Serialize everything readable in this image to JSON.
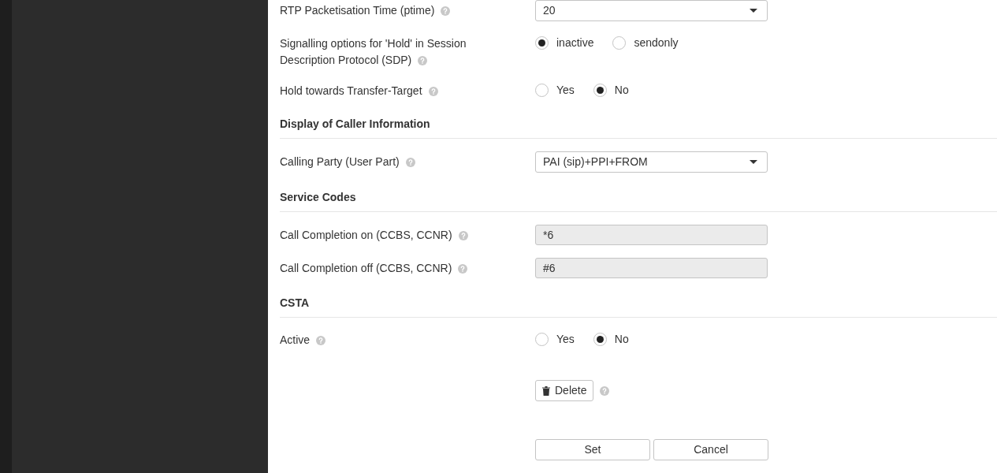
{
  "form": [
    {
      "kind": "select",
      "label": "RTP Packetisation Time (ptime)",
      "help": true,
      "value": "20"
    },
    {
      "kind": "radio",
      "label": "Signalling options for 'Hold' in Session Description Protocol (SDP)",
      "help": true,
      "options": [
        {
          "label": "inactive",
          "selected": true
        },
        {
          "label": "sendonly",
          "selected": false
        }
      ]
    },
    {
      "kind": "radio",
      "label": "Hold towards Transfer-Target",
      "help": true,
      "options": [
        {
          "label": "Yes",
          "selected": false
        },
        {
          "label": "No",
          "selected": true
        }
      ]
    },
    {
      "kind": "heading",
      "label": "Display of Caller Information"
    },
    {
      "kind": "select",
      "label": "Calling Party (User Part)",
      "help": true,
      "value": "PAI (sip)+PPI+FROM"
    },
    {
      "kind": "heading",
      "label": "Service Codes"
    },
    {
      "kind": "field",
      "label": "Call Completion on (CCBS, CCNR)",
      "help": true,
      "value": "*6",
      "disabled": true
    },
    {
      "kind": "field",
      "label": "Call Completion off (CCBS, CCNR)",
      "help": true,
      "value": "#6",
      "disabled": true
    },
    {
      "kind": "heading",
      "label": "CSTA"
    },
    {
      "kind": "radio",
      "label": "Active",
      "help": true,
      "options": [
        {
          "label": "Yes",
          "selected": false
        },
        {
          "label": "No",
          "selected": true
        }
      ]
    },
    {
      "kind": "action",
      "button": "Delete",
      "help": true
    }
  ],
  "buttons": [
    "Set",
    "Cancel"
  ]
}
